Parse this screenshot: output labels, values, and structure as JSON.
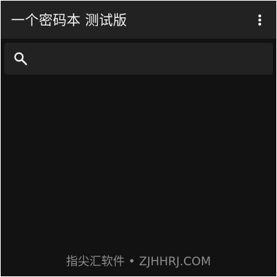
{
  "app_bar": {
    "title": "一个密码本 测试版",
    "menu_icon": "more-vert-icon",
    "background": "#222222",
    "title_color": "#f2f2f2"
  },
  "search": {
    "icon": "search-icon",
    "value": "",
    "placeholder": ""
  },
  "content": {
    "background": "#121212"
  },
  "watermark": {
    "text": "指尖汇软件 • ZJHHRJ.COM"
  }
}
